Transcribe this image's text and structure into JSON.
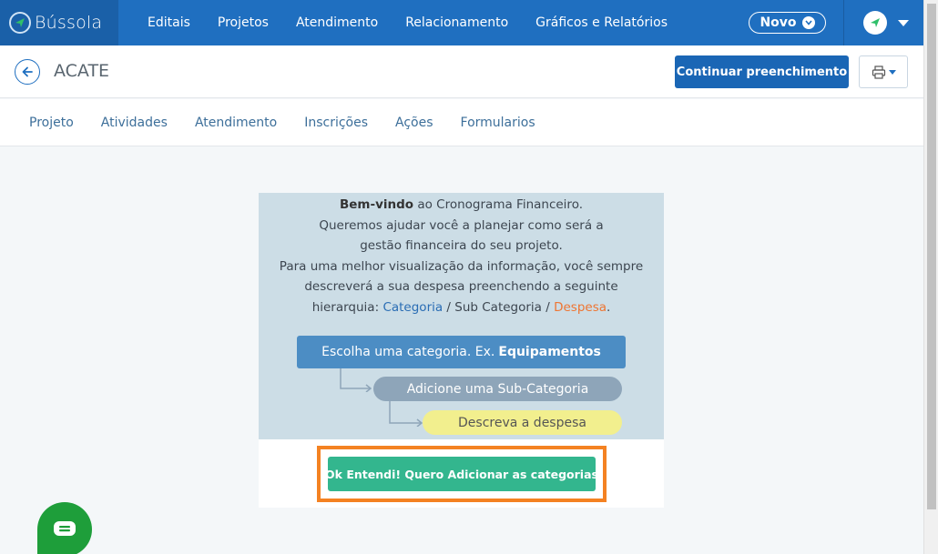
{
  "app": {
    "brand": "Bússola",
    "colors": {
      "primary": "#1f6fc0",
      "accent_green": "#33b68e",
      "highlight_orange": "#f48222"
    }
  },
  "navbar": {
    "items": [
      {
        "label": "Editais"
      },
      {
        "label": "Projetos"
      },
      {
        "label": "Atendimento"
      },
      {
        "label": "Relacionamento"
      },
      {
        "label": "Gráficos e Relatórios"
      }
    ],
    "new_button_label": "Novo",
    "icons": {
      "brand": "compass-icon",
      "novo": "chevron-down-icon",
      "user": "user-avatar-icon",
      "user_menu": "caret-down-icon"
    }
  },
  "page": {
    "title": "ACATE",
    "continue_button_label": "Continuar preenchimento",
    "icons": {
      "back": "back-arrow-icon",
      "print": "printer-icon"
    }
  },
  "tabs": [
    {
      "label": "Projeto"
    },
    {
      "label": "Atividades"
    },
    {
      "label": "Atendimento"
    },
    {
      "label": "Inscrições"
    },
    {
      "label": "Ações"
    },
    {
      "label": "Formularios"
    }
  ],
  "welcome": {
    "line1_bold": "Bem-vindo",
    "line1_rest": " ao Cronograma Financeiro.",
    "line2": "Queremos ajudar você a planejar como será a gestão financeira do seu projeto.",
    "line3": "Para uma melhor visualização da informação, você sempre descreverá a sua despesa preenchendo a seguinte hierarquia: ",
    "hier_categoria": "Categoria",
    "hier_sep1": " / Sub Categoria / ",
    "hier_despesa": "Despesa",
    "hier_end": ".",
    "step_category_text": "Escolha uma categoria. Ex.",
    "step_category_example": "Equipamentos",
    "step_subcategory": "Adicione uma Sub-Categoria",
    "step_expense": "Descreva a despesa",
    "ok_button_label": "Ok Entendi! Quero Adicionar as categorias"
  },
  "chat": {
    "icon": "chat-icon"
  }
}
